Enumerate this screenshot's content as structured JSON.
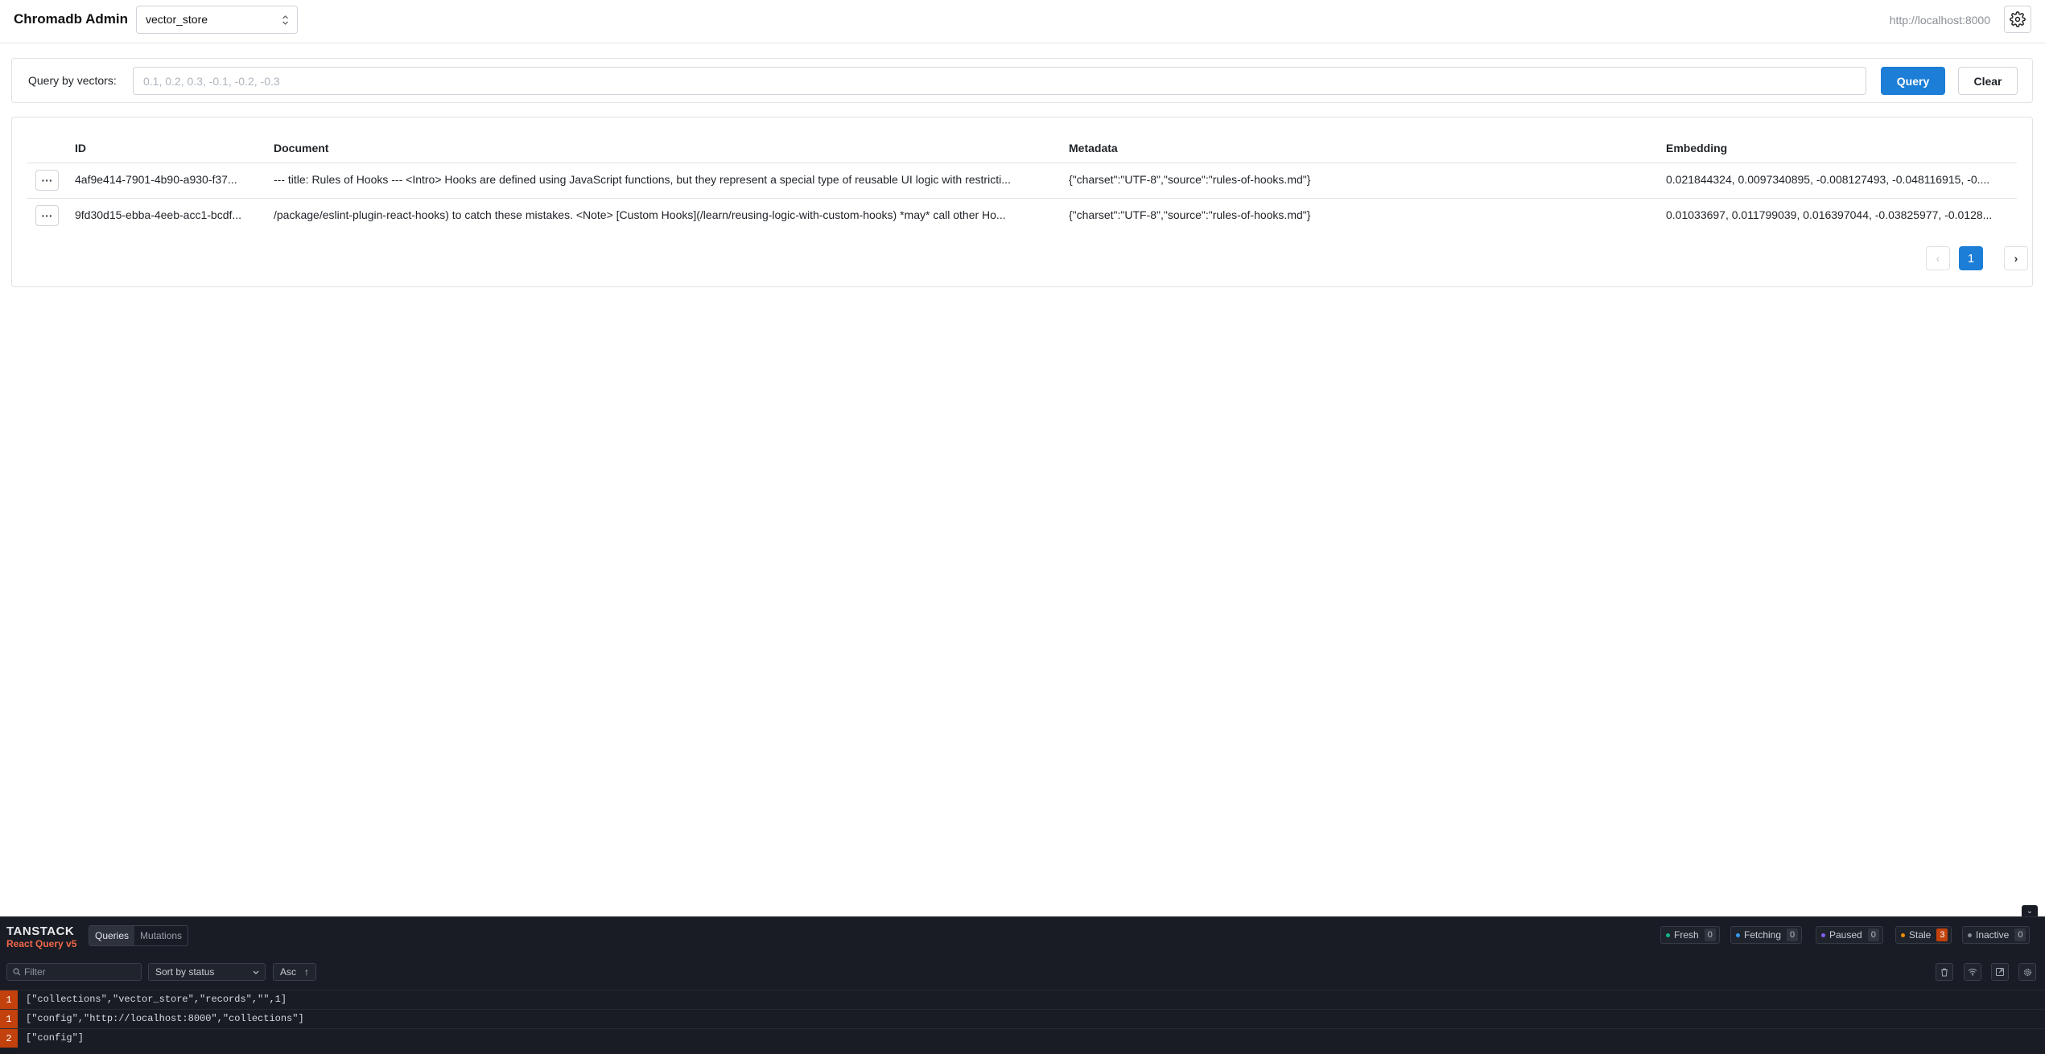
{
  "header": {
    "app_title": "Chromadb Admin",
    "collection": "vector_store",
    "server_url": "http://localhost:8000"
  },
  "query": {
    "label": "Query by vectors:",
    "placeholder": "0.1, 0.2, 0.3, -0.1, -0.2, -0.3",
    "value": "",
    "query_button": "Query",
    "clear_button": "Clear"
  },
  "table": {
    "columns": [
      "ID",
      "Document",
      "Metadata",
      "Embedding"
    ],
    "rows": [
      {
        "id": "4af9e414-7901-4b90-a930-f37...",
        "document": "--- title: Rules of Hooks --- <Intro> Hooks are defined using JavaScript functions, but they represent a special type of reusable UI logic with restricti...",
        "metadata": "{\"charset\":\"UTF-8\",\"source\":\"rules-of-hooks.md\"}",
        "embedding": "0.021844324, 0.0097340895, -0.008127493, -0.048116915, -0...."
      },
      {
        "id": "9fd30d15-ebba-4eeb-acc1-bcdf...",
        "document": "/package/eslint-plugin-react-hooks) to catch these mistakes. <Note> [Custom Hooks](/learn/reusing-logic-with-custom-hooks) *may* call other Ho...",
        "metadata": "{\"charset\":\"UTF-8\",\"source\":\"rules-of-hooks.md\"}",
        "embedding": "0.01033697, 0.011799039, 0.016397044, -0.03825977, -0.0128..."
      }
    ],
    "current_page": "1"
  },
  "devtools": {
    "logo_top": "TANSTACK",
    "logo_bottom": "React Query v5",
    "tabs": [
      "Queries",
      "Mutations"
    ],
    "statuses": [
      {
        "label": "Fresh",
        "count": "0",
        "color": "#12b886"
      },
      {
        "label": "Fetching",
        "count": "0",
        "color": "#339af0"
      },
      {
        "label": "Paused",
        "count": "0",
        "color": "#845ef7"
      },
      {
        "label": "Stale",
        "count": "3",
        "color": "#f08c00"
      },
      {
        "label": "Inactive",
        "count": "0",
        "color": "#868e96"
      }
    ],
    "filter_placeholder": "Filter",
    "sort": "Sort by status",
    "order": "Asc",
    "queries": [
      {
        "count": "1",
        "key": "[\"collections\",\"vector_store\",\"records\",\"\",1]"
      },
      {
        "count": "1",
        "key": "[\"config\",\"http://localhost:8000\",\"collections\"]"
      },
      {
        "count": "2",
        "key": "[\"config\"]"
      }
    ]
  },
  "colors": {
    "accent": "#1c7ed6",
    "stale_badge": "#c2410c",
    "devtools_bg": "#191c24"
  }
}
